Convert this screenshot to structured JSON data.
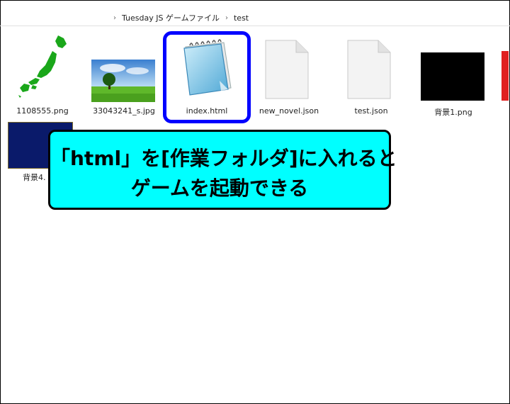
{
  "breadcrumb": {
    "items": [
      "Tuesday JS ゲームファイル",
      "test"
    ]
  },
  "files": [
    {
      "name": "1108555.png",
      "icon": "japan-map-thumbnail"
    },
    {
      "name": "33043241_s.jpg",
      "icon": "tree-landscape-thumbnail"
    },
    {
      "name": "index.html",
      "icon": "notepad-icon",
      "highlighted": true
    },
    {
      "name": "new_novel.json",
      "icon": "blank-document-icon"
    },
    {
      "name": "test.json",
      "icon": "blank-document-icon"
    },
    {
      "name": "背景1.png",
      "icon": "black-image-thumbnail"
    },
    {
      "name": "背景4.",
      "icon": "navy-image-thumbnail"
    }
  ],
  "callout": {
    "line1": "「html」を[作業フォルダ]に入れると",
    "line2": "ゲームを起動できる"
  },
  "colors": {
    "highlight_border": "#0000ff",
    "callout_bg": "#00ffff",
    "callout_text": "#000000"
  }
}
